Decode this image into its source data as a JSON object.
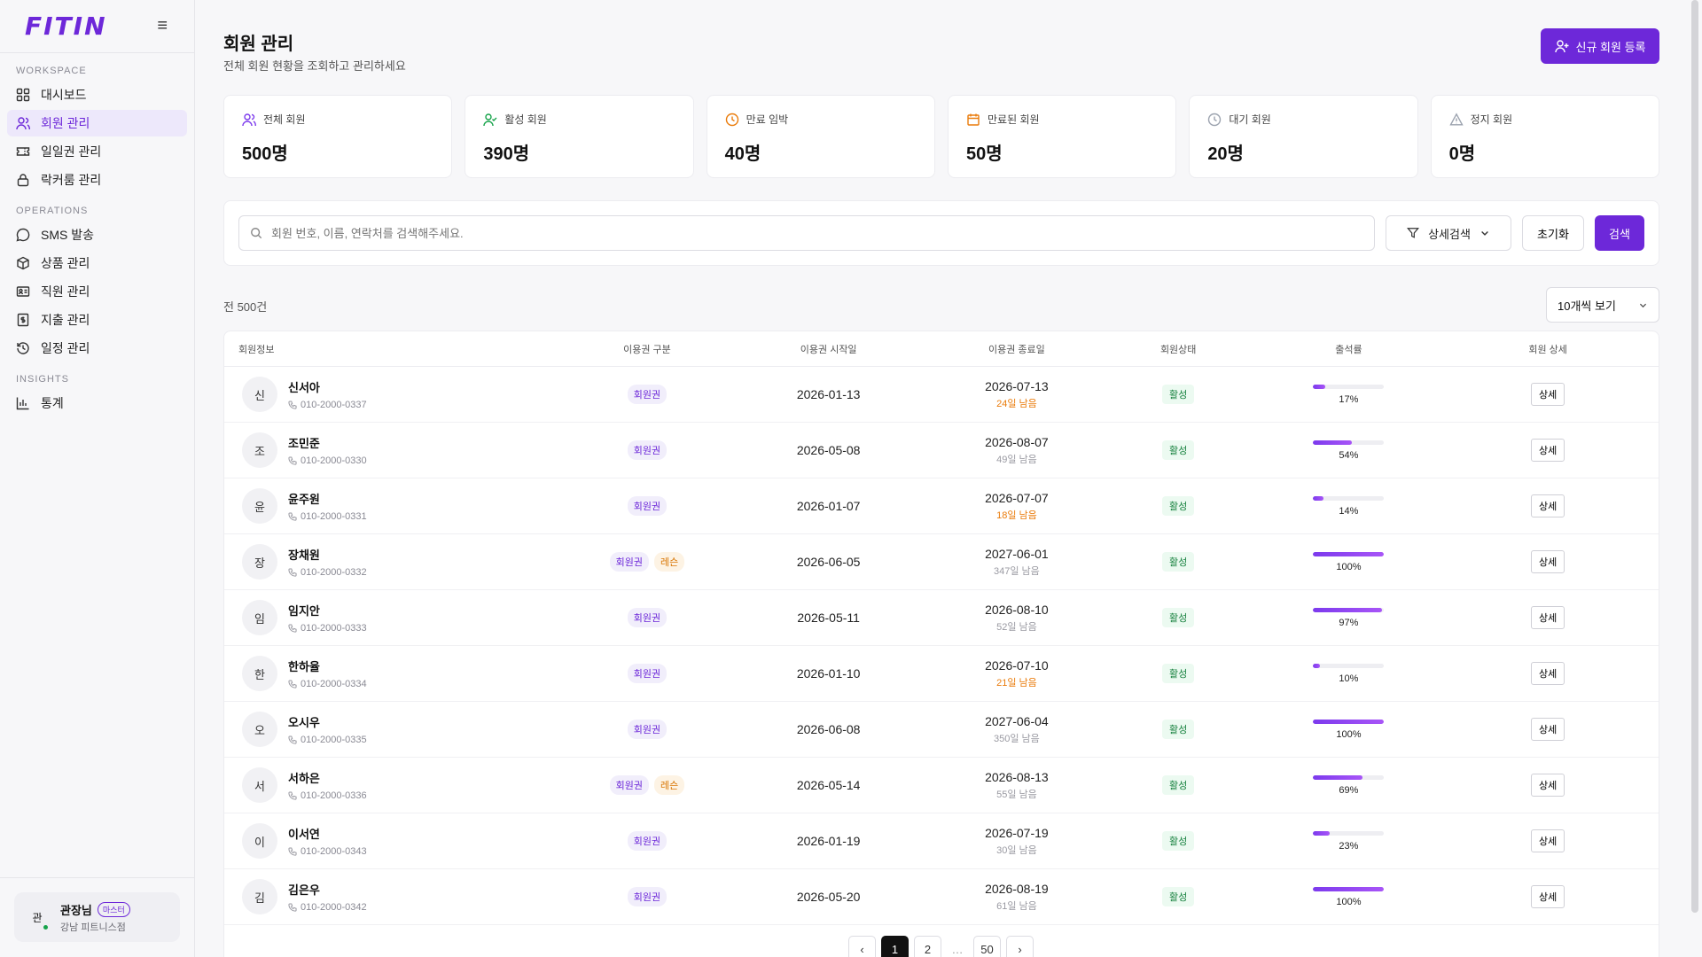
{
  "app": {
    "logo": "FITIN"
  },
  "sidebar": {
    "sections": [
      {
        "label": "WORKSPACE"
      },
      {
        "label": "OPERATIONS"
      },
      {
        "label": "INSIGHTS"
      }
    ],
    "items": [
      {
        "label": "대시보드",
        "icon": "grid-icon"
      },
      {
        "label": "회원 관리",
        "icon": "users-icon"
      },
      {
        "label": "일일권 관리",
        "icon": "ticket-icon"
      },
      {
        "label": "락커룸 관리",
        "icon": "lock-icon"
      },
      {
        "label": "SMS 발송",
        "icon": "message-icon"
      },
      {
        "label": "상품 관리",
        "icon": "box-icon"
      },
      {
        "label": "직원 관리",
        "icon": "id-card-icon"
      },
      {
        "label": "지출 관리",
        "icon": "receipt-icon"
      },
      {
        "label": "일정 관리",
        "icon": "history-icon"
      },
      {
        "label": "통계",
        "icon": "bar-chart-icon"
      }
    ],
    "user": {
      "initial": "관",
      "name": "관장님",
      "role": "마스터",
      "branch": "강남 피트니스점"
    }
  },
  "header": {
    "title": "회원 관리",
    "subtitle": "전체 회원 현황을 조회하고 관리하세요",
    "new_button": "신규 회원 등록"
  },
  "stats": [
    {
      "label": "전체 회원",
      "value": "500명",
      "icon": "users-icon",
      "color": "#7c3aed"
    },
    {
      "label": "활성 회원",
      "value": "390명",
      "icon": "user-check-icon",
      "color": "#16a34a"
    },
    {
      "label": "만료 임박",
      "value": "40명",
      "icon": "clock-icon",
      "color": "#ea7c0c"
    },
    {
      "label": "만료된 회원",
      "value": "50명",
      "icon": "calendar-icon",
      "color": "#ea7c0c"
    },
    {
      "label": "대기 회원",
      "value": "20명",
      "icon": "clock-icon",
      "color": "#9ca3af"
    },
    {
      "label": "정지 회원",
      "value": "0명",
      "icon": "warning-icon",
      "color": "#9ca3af"
    }
  ],
  "search": {
    "placeholder": "회원 번호, 이름, 연락처를 검색해주세요.",
    "filter_label": "상세검색",
    "reset_label": "초기화",
    "search_label": "검색"
  },
  "list": {
    "total": "전 500건",
    "per_page": "10개씩 보기",
    "columns": [
      "회원정보",
      "이용권 구분",
      "이용권 시작일",
      "이용권 종료일",
      "회원상태",
      "출석률",
      "회원 상세"
    ],
    "detail_label": "상세",
    "rows": [
      {
        "initial": "신",
        "name": "신서아",
        "phone": "010-2000-0337",
        "tags": [
          "회원권"
        ],
        "start": "2026-01-13",
        "end": "2026-07-13",
        "remain": "24일 남음",
        "warn": true,
        "status": "활성",
        "attendance": 17
      },
      {
        "initial": "조",
        "name": "조민준",
        "phone": "010-2000-0330",
        "tags": [
          "회원권"
        ],
        "start": "2026-05-08",
        "end": "2026-08-07",
        "remain": "49일 남음",
        "warn": false,
        "status": "활성",
        "attendance": 54
      },
      {
        "initial": "윤",
        "name": "윤주원",
        "phone": "010-2000-0331",
        "tags": [
          "회원권"
        ],
        "start": "2026-01-07",
        "end": "2026-07-07",
        "remain": "18일 남음",
        "warn": true,
        "status": "활성",
        "attendance": 14
      },
      {
        "initial": "장",
        "name": "장채원",
        "phone": "010-2000-0332",
        "tags": [
          "회원권",
          "레슨"
        ],
        "start": "2026-06-05",
        "end": "2027-06-01",
        "remain": "347일 남음",
        "warn": false,
        "status": "활성",
        "attendance": 100
      },
      {
        "initial": "임",
        "name": "임지안",
        "phone": "010-2000-0333",
        "tags": [
          "회원권"
        ],
        "start": "2026-05-11",
        "end": "2026-08-10",
        "remain": "52일 남음",
        "warn": false,
        "status": "활성",
        "attendance": 97
      },
      {
        "initial": "한",
        "name": "한하율",
        "phone": "010-2000-0334",
        "tags": [
          "회원권"
        ],
        "start": "2026-01-10",
        "end": "2026-07-10",
        "remain": "21일 남음",
        "warn": true,
        "status": "활성",
        "attendance": 10
      },
      {
        "initial": "오",
        "name": "오시우",
        "phone": "010-2000-0335",
        "tags": [
          "회원권"
        ],
        "start": "2026-06-08",
        "end": "2027-06-04",
        "remain": "350일 남음",
        "warn": false,
        "status": "활성",
        "attendance": 100
      },
      {
        "initial": "서",
        "name": "서하은",
        "phone": "010-2000-0336",
        "tags": [
          "회원권",
          "레슨"
        ],
        "start": "2026-05-14",
        "end": "2026-08-13",
        "remain": "55일 남음",
        "warn": false,
        "status": "활성",
        "attendance": 69
      },
      {
        "initial": "이",
        "name": "이서연",
        "phone": "010-2000-0343",
        "tags": [
          "회원권"
        ],
        "start": "2026-01-19",
        "end": "2026-07-19",
        "remain": "30일 남음",
        "warn": false,
        "status": "활성",
        "attendance": 23
      },
      {
        "initial": "김",
        "name": "김은우",
        "phone": "010-2000-0342",
        "tags": [
          "회원권"
        ],
        "start": "2026-05-20",
        "end": "2026-08-19",
        "remain": "61일 남음",
        "warn": false,
        "status": "활성",
        "attendance": 100
      }
    ]
  },
  "pagination": {
    "prev": "‹",
    "pages": [
      "1",
      "2",
      "…",
      "50"
    ],
    "current": "1",
    "next": "›"
  }
}
